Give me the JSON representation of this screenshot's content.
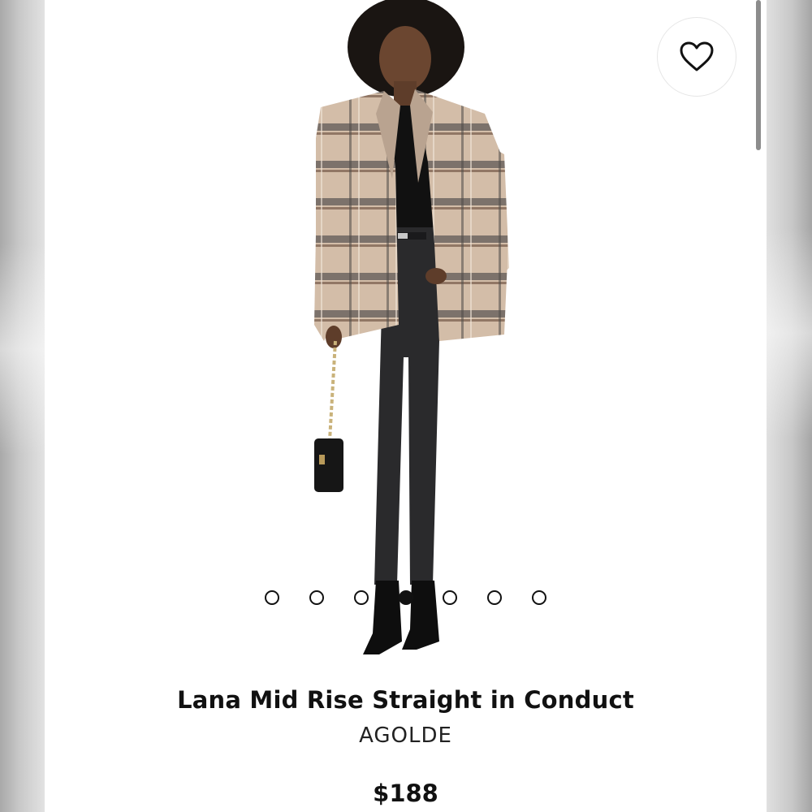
{
  "product": {
    "title": "Lana Mid Rise Straight in Conduct",
    "brand": "AGOLDE",
    "price": "$188"
  },
  "gallery": {
    "image_count": 7,
    "active_index": 3,
    "favorite_icon": "heart-outline-icon"
  },
  "colors": {
    "text": "#111111",
    "background": "#ffffff",
    "jacket_base": "#cdb59f",
    "jacket_stripe": "#5b5550",
    "jeans": "#2a2a2c"
  }
}
